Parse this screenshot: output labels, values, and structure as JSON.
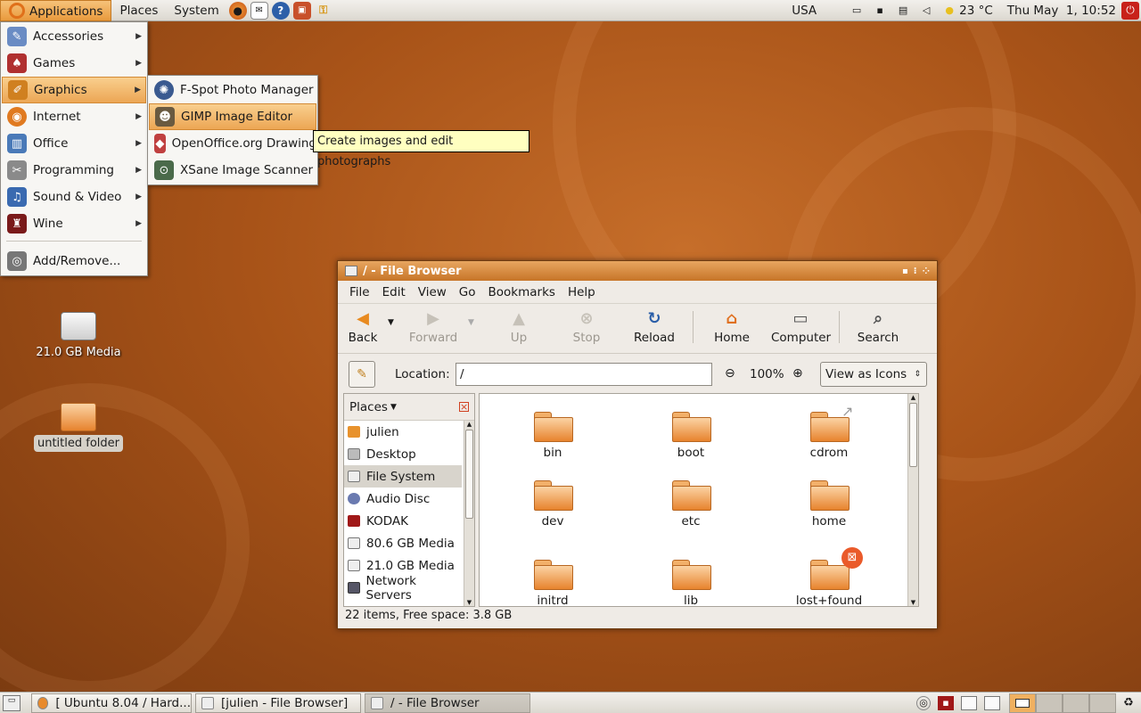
{
  "top_panel": {
    "menus": [
      "Applications",
      "Places",
      "System"
    ],
    "keyboard_layout": "USA",
    "weather": "23 °C",
    "clock": "Thu May  1, 10:52"
  },
  "applications_menu": {
    "items": [
      {
        "label": "Accessories",
        "icon": "accessories-icon",
        "color": "#6a8cc4"
      },
      {
        "label": "Games",
        "icon": "games-icon",
        "color": "#b03030"
      },
      {
        "label": "Graphics",
        "icon": "graphics-icon",
        "color": "#d08020"
      },
      {
        "label": "Internet",
        "icon": "internet-icon",
        "color": "#e07a20"
      },
      {
        "label": "Office",
        "icon": "office-icon",
        "color": "#4a7ab8"
      },
      {
        "label": "Programming",
        "icon": "programming-icon",
        "color": "#8a8a8a"
      },
      {
        "label": "Sound & Video",
        "icon": "sound-video-icon",
        "color": "#3a6ab0"
      },
      {
        "label": "Wine",
        "icon": "wine-icon",
        "color": "#7a1a1a"
      }
    ],
    "extra": "Add/Remove..."
  },
  "graphics_submenu": {
    "items": [
      {
        "label": "F-Spot Photo Manager",
        "icon": "fspot-icon"
      },
      {
        "label": "GIMP Image Editor",
        "icon": "gimp-icon"
      },
      {
        "label": "OpenOffice.org Drawing",
        "icon": "openoffice-draw-icon"
      },
      {
        "label": "XSane Image Scanner",
        "icon": "xsane-icon"
      }
    ]
  },
  "tooltip": "Create images and edit photographs",
  "desktop": {
    "icons": [
      "21.0 GB Media",
      "untitled folder"
    ]
  },
  "file_browser": {
    "title": "/ - File Browser",
    "menubar": [
      "File",
      "Edit",
      "View",
      "Go",
      "Bookmarks",
      "Help"
    ],
    "toolbar": {
      "back": "Back",
      "forward": "Forward",
      "up": "Up",
      "stop": "Stop",
      "reload": "Reload",
      "home": "Home",
      "computer": "Computer",
      "search": "Search"
    },
    "location_label": "Location:",
    "location_value": "/",
    "zoom": "100%",
    "view_mode": "View as Icons",
    "places_header": "Places",
    "places": [
      "julien",
      "Desktop",
      "File System",
      "Audio Disc",
      "KODAK",
      "80.6 GB Media",
      "21.0 GB Media",
      "Network Servers"
    ],
    "selected_place": "File System",
    "folders": [
      "bin",
      "boot",
      "cdrom",
      "dev",
      "etc",
      "home",
      "initrd",
      "lib",
      "lost+found"
    ],
    "status": "22 items, Free space: 3.8 GB"
  },
  "taskbar": {
    "tasks": [
      "[ Ubuntu 8.04 / Hard...",
      "[julien - File Browser]",
      "/ - File Browser"
    ]
  }
}
